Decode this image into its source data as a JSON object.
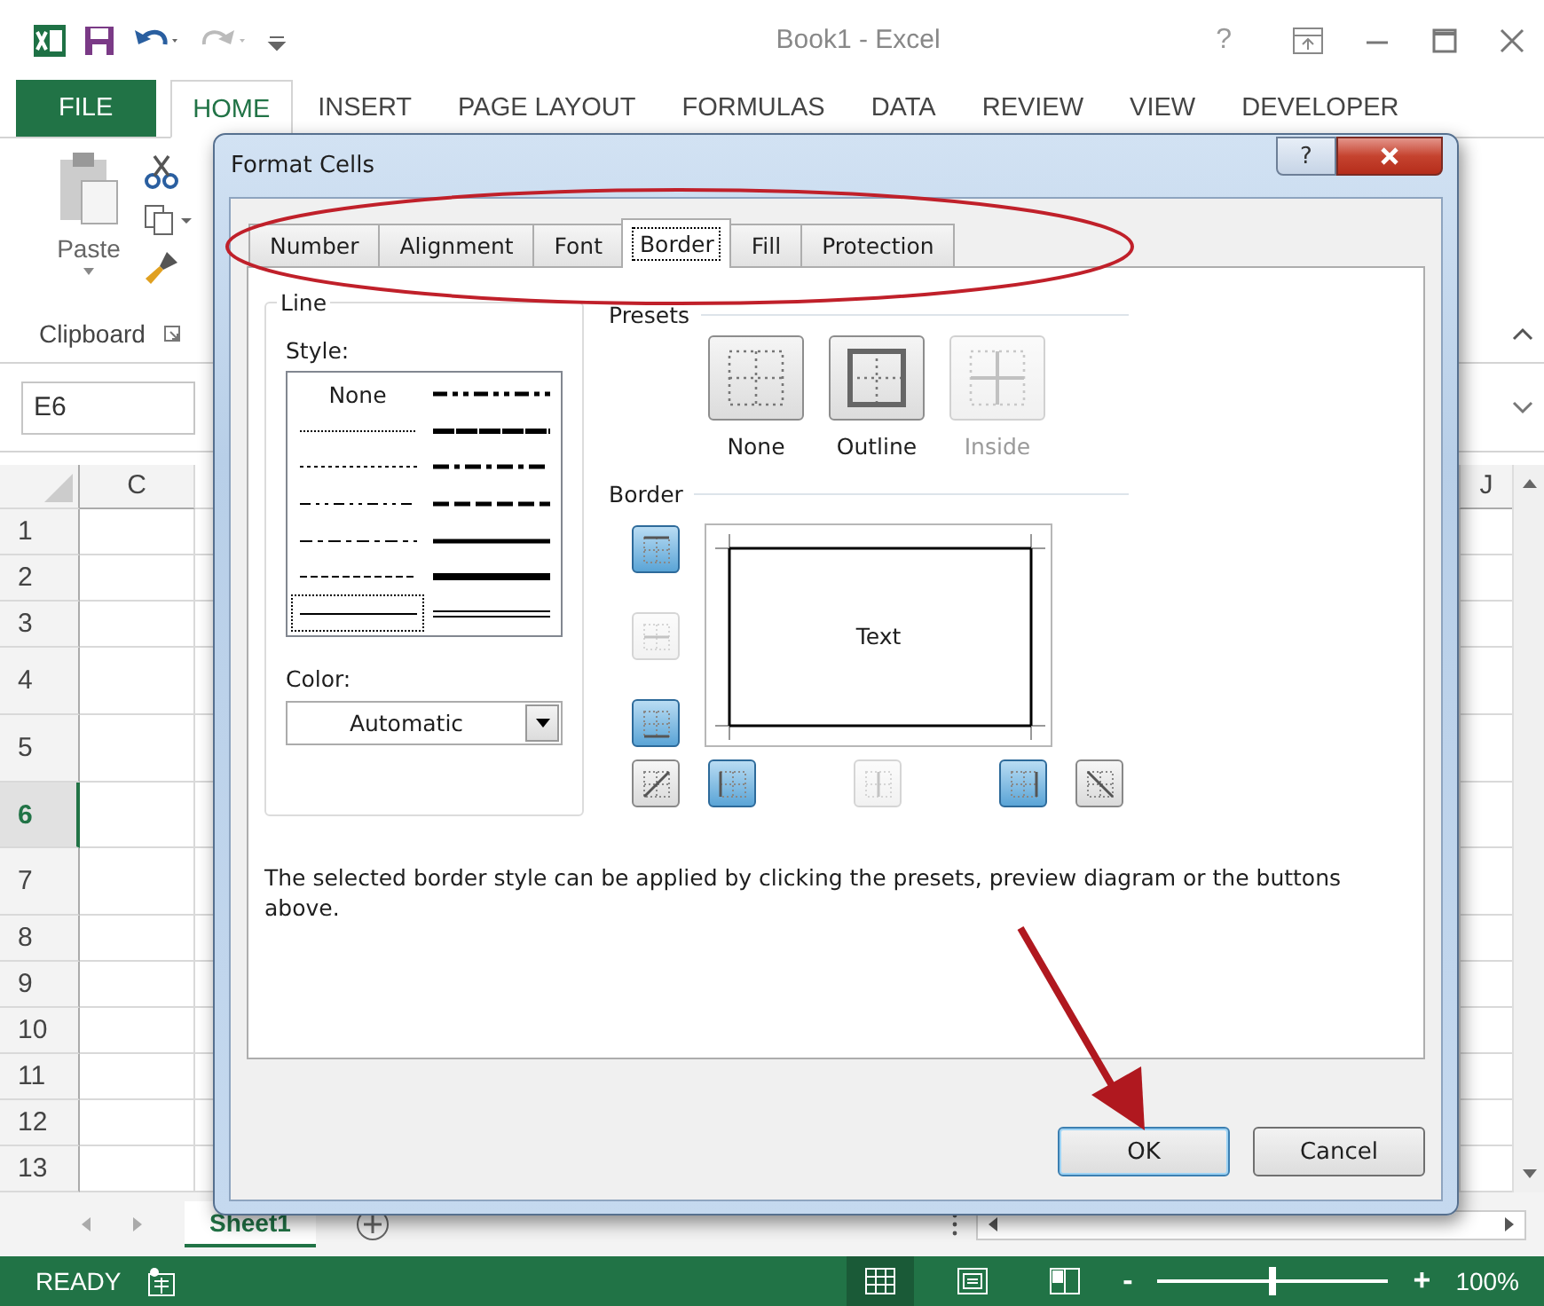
{
  "window": {
    "title": "Book1 - Excel",
    "help_glyph": "?"
  },
  "ribbon_tabs": [
    {
      "label": "FILE",
      "kind": "file",
      "selected": false
    },
    {
      "label": "HOME",
      "kind": "tab",
      "selected": true
    },
    {
      "label": "INSERT",
      "kind": "tab",
      "selected": false
    },
    {
      "label": "PAGE LAYOUT",
      "kind": "tab",
      "selected": false
    },
    {
      "label": "FORMULAS",
      "kind": "tab",
      "selected": false
    },
    {
      "label": "DATA",
      "kind": "tab",
      "selected": false
    },
    {
      "label": "REVIEW",
      "kind": "tab",
      "selected": false
    },
    {
      "label": "VIEW",
      "kind": "tab",
      "selected": false
    },
    {
      "label": "DEVELOPER",
      "kind": "tab",
      "selected": false
    }
  ],
  "clipboard": {
    "paste_label": "Paste",
    "group_label": "Clipboard"
  },
  "name_box": {
    "value": "E6"
  },
  "sheet": {
    "columns": [
      {
        "label": "C"
      },
      {
        "label": "J"
      }
    ],
    "rows": [
      {
        "label": "1",
        "kind": "normal",
        "selected": false
      },
      {
        "label": "2",
        "kind": "normal",
        "selected": false
      },
      {
        "label": "3",
        "kind": "normal",
        "selected": false
      },
      {
        "label": "4",
        "kind": "tall",
        "selected": false
      },
      {
        "label": "5",
        "kind": "tall",
        "selected": false
      },
      {
        "label": "6",
        "kind": "tall",
        "selected": true
      },
      {
        "label": "7",
        "kind": "tall",
        "selected": false
      },
      {
        "label": "8",
        "kind": "normal",
        "selected": false
      },
      {
        "label": "9",
        "kind": "normal",
        "selected": false
      },
      {
        "label": "10",
        "kind": "normal",
        "selected": false
      },
      {
        "label": "11",
        "kind": "normal",
        "selected": false
      },
      {
        "label": "12",
        "kind": "normal",
        "selected": false
      },
      {
        "label": "13",
        "kind": "normal",
        "selected": false
      }
    ]
  },
  "sheet_tabs": [
    {
      "label": "Sheet1",
      "selected": true
    }
  ],
  "status_bar": {
    "status": "READY",
    "views": [
      {
        "kind": "normal",
        "selected": true
      },
      {
        "kind": "page-layout",
        "selected": false
      },
      {
        "kind": "page-break",
        "selected": false
      }
    ],
    "zoom_out": "-",
    "zoom_slider": {
      "level": 0.5
    },
    "zoom_in": "+",
    "zoom": "100%"
  },
  "dialog": {
    "title": "Format Cells",
    "help_glyph": "?",
    "tabs": [
      {
        "label": "Number",
        "selected": false
      },
      {
        "label": "Alignment",
        "selected": false
      },
      {
        "label": "Font",
        "selected": false
      },
      {
        "label": "Border",
        "selected": true
      },
      {
        "label": "Fill",
        "selected": false
      },
      {
        "label": "Protection",
        "selected": false
      }
    ],
    "line": {
      "legend": "Line",
      "style_label": "Style:",
      "color_label": "Color:",
      "color_value": "Automatic",
      "styles": [
        {
          "kind": "none",
          "label": "None",
          "selected": false
        },
        {
          "kind": "hair",
          "selected": false
        },
        {
          "kind": "dotted",
          "selected": false
        },
        {
          "kind": "dash-dot-dot",
          "selected": false
        },
        {
          "kind": "dash-dot",
          "selected": false
        },
        {
          "kind": "dashed",
          "selected": false
        },
        {
          "kind": "thin",
          "selected": true
        },
        {
          "kind": "medium-dash-dot-dot",
          "selected": false
        },
        {
          "kind": "slanted-dash-dot",
          "selected": false
        },
        {
          "kind": "medium-dash-dot",
          "selected": false
        },
        {
          "kind": "medium-dashed",
          "selected": false
        },
        {
          "kind": "medium",
          "selected": false
        },
        {
          "kind": "thick",
          "selected": false
        },
        {
          "kind": "double",
          "selected": false
        }
      ]
    },
    "presets": {
      "legend": "Presets",
      "items": [
        {
          "label": "None",
          "kind": "none",
          "disabled": false
        },
        {
          "label": "Outline",
          "kind": "outline",
          "disabled": false
        },
        {
          "label": "Inside",
          "kind": "inside",
          "disabled": true
        }
      ]
    },
    "border": {
      "legend": "Border",
      "preview_text": "Text",
      "buttons": [
        {
          "kind": "top",
          "on": true,
          "disabled": false
        },
        {
          "kind": "middle-h",
          "on": false,
          "disabled": true
        },
        {
          "kind": "bottom",
          "on": true,
          "disabled": false
        },
        {
          "kind": "diag-up",
          "on": false,
          "disabled": false
        },
        {
          "kind": "left",
          "on": true,
          "disabled": false
        },
        {
          "kind": "middle-v",
          "on": false,
          "disabled": true
        },
        {
          "kind": "right",
          "on": true,
          "disabled": false
        },
        {
          "kind": "diag-down",
          "on": false,
          "disabled": false
        }
      ]
    },
    "description": "The selected border style can be applied by clicking the presets, preview diagram or the buttons above.",
    "buttons": [
      {
        "label": "OK",
        "default": true
      },
      {
        "label": "Cancel",
        "default": false
      }
    ]
  },
  "annotations": {
    "tabs_ellipse": true,
    "ok_arrow": true
  }
}
